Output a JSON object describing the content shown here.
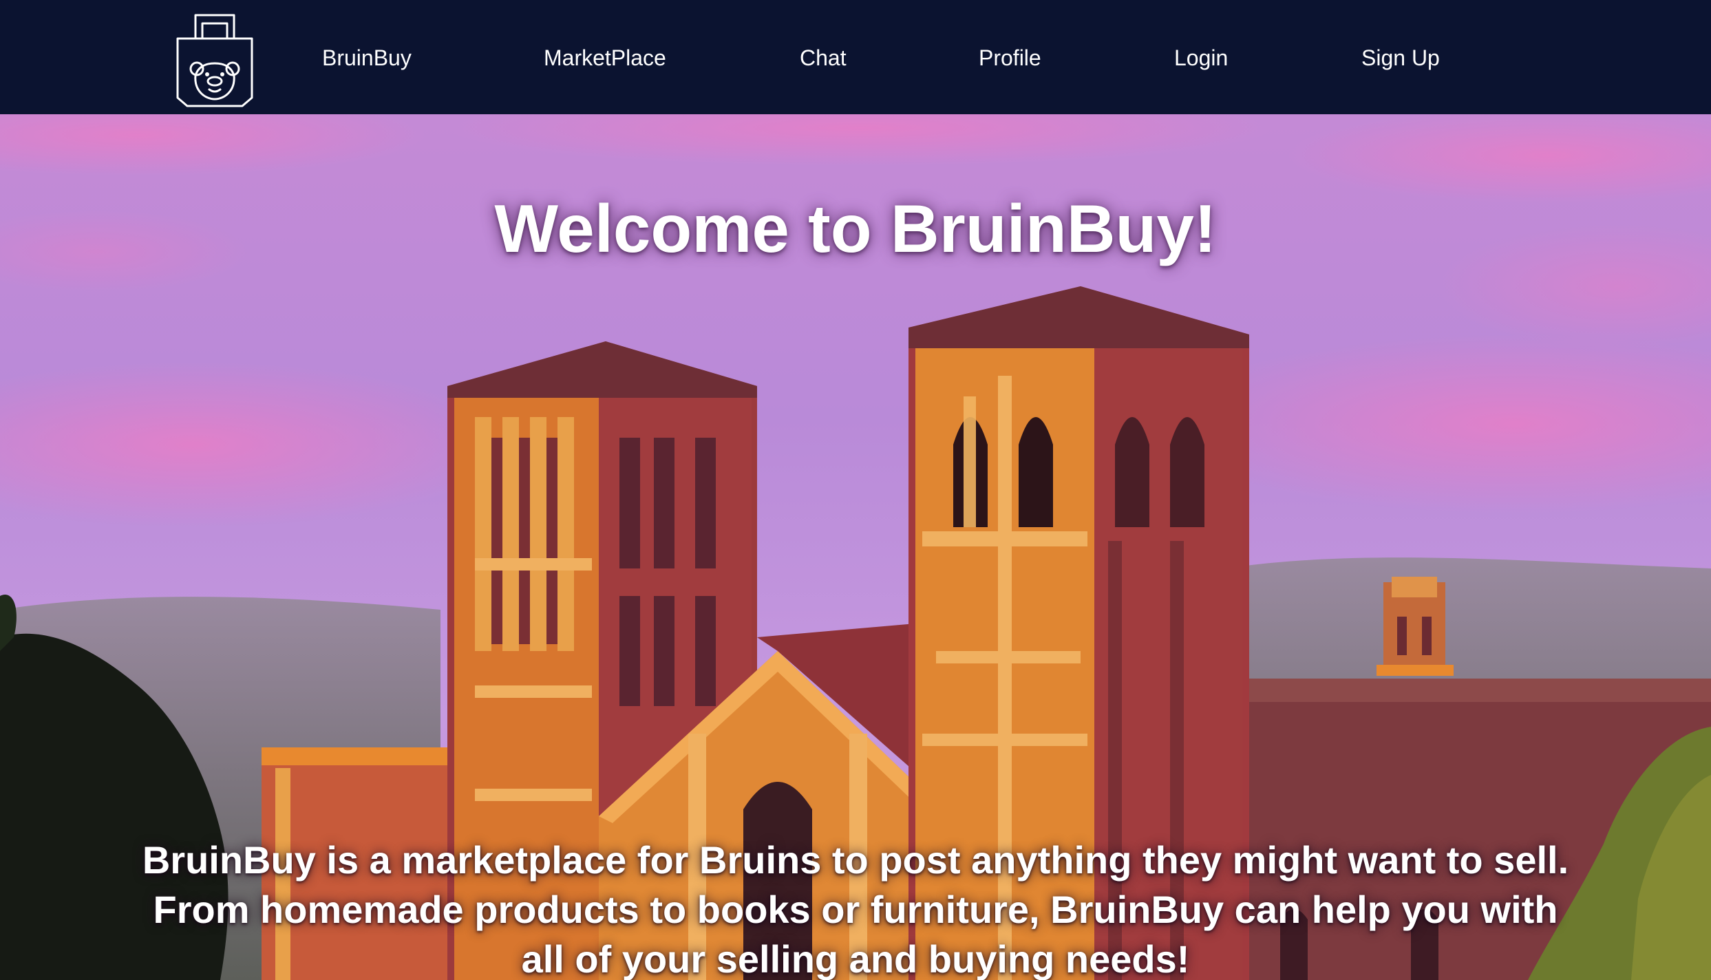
{
  "nav": {
    "logo_icon": "shopping-bag-bear-icon",
    "links": [
      {
        "label": "BruinBuy"
      },
      {
        "label": "MarketPlace"
      },
      {
        "label": "Chat"
      },
      {
        "label": "Profile"
      },
      {
        "label": "Login"
      },
      {
        "label": "Sign Up"
      }
    ],
    "background": "#0b1330",
    "text_color": "#ffffff"
  },
  "hero": {
    "title": "Welcome to BruinBuy!",
    "description": "BruinBuy is a marketplace for Bruins to post anything they might want to sell. From homemade products to books or furniture, BruinBuy can help you with all of your selling and buying needs!",
    "image": "royce-hall-painting",
    "sky_color": "#b98ad8",
    "brick_color": "#9c3a3c",
    "orange_color": "#e8892f"
  }
}
